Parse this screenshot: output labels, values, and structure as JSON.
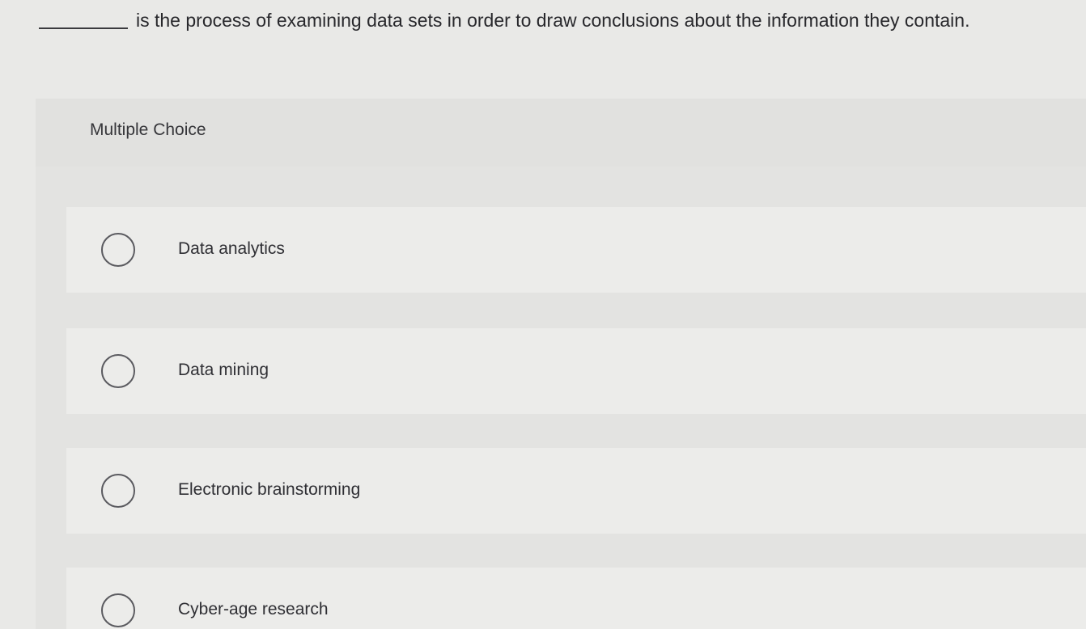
{
  "question": {
    "text": "is the process of examining data sets in order to draw conclusions about the information they contain."
  },
  "choices": {
    "label": "Multiple Choice",
    "options": [
      "Data analytics",
      "Data mining",
      "Electronic brainstorming",
      "Cyber-age research"
    ]
  }
}
